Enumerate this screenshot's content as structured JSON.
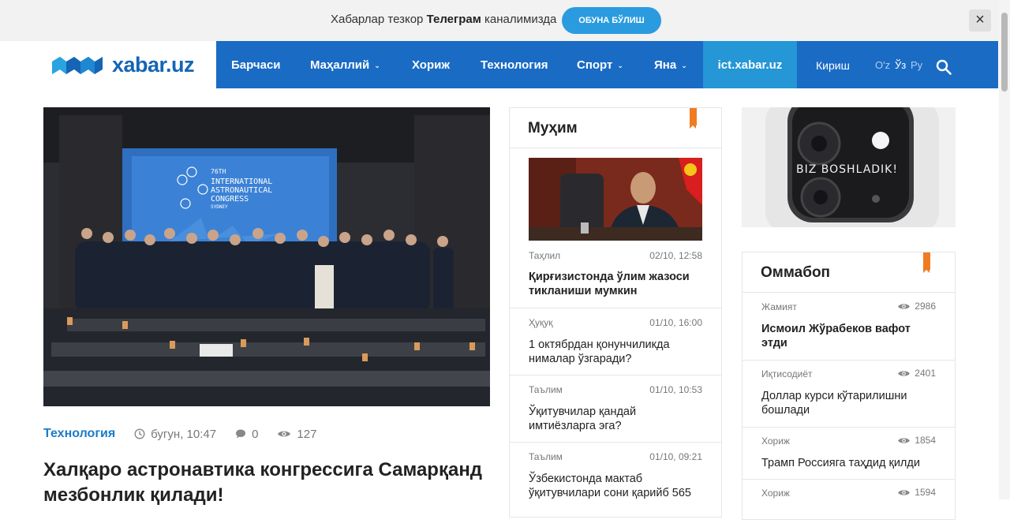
{
  "banner": {
    "text_before": "Хабарлар тезкор",
    "text_bold": "Телеграм",
    "text_after": "каналимизда",
    "subscribe_label": "ОБУНА БЎЛИШ",
    "close_label": "×"
  },
  "logo": {
    "text": "xabar.uz",
    "color": "#1565b5"
  },
  "nav": {
    "items": [
      {
        "label": "Барчаси",
        "dropdown": false
      },
      {
        "label": "Маҳаллий",
        "dropdown": true
      },
      {
        "label": "Хориж",
        "dropdown": false
      },
      {
        "label": "Технология",
        "dropdown": false
      },
      {
        "label": "Спорт",
        "dropdown": true
      },
      {
        "label": "Яна",
        "dropdown": true
      }
    ],
    "ict_label": "ict.xabar.uz",
    "login_label": "Кириш",
    "languages": [
      "O'z",
      "Ўз",
      "Ру"
    ],
    "active_language": "Ўз",
    "search_icon": "search-icon",
    "bg_color": "#1a6bc4",
    "ict_color": "#2596d6"
  },
  "hero": {
    "image_text": {
      "line1": "76TH",
      "line2": "INTERNATIONAL",
      "line3": "ASTRONAUTICAL",
      "line4": "CONGRESS",
      "line5": "SYDNEY"
    },
    "category": "Технология",
    "time": "бугун, 10:47",
    "comments": "0",
    "views": "127",
    "title": "Халқаро астронавтика конгрессига Самарқанд мезбонлик қилади!"
  },
  "muhim": {
    "heading": "Муҳим",
    "items": [
      {
        "category": "Таҳлил",
        "time": "02/10, 12:58",
        "title": "Қирғизистонда ўлим жазоси тикланиши мумкин",
        "bold": true
      },
      {
        "category": "Ҳуқуқ",
        "time": "01/10, 16:00",
        "title": "1 октябрдан қонунчиликда нималар ўзгаради?",
        "bold": false
      },
      {
        "category": "Таълим",
        "time": "01/10, 10:53",
        "title": "Ўқитувчилар қандай имтиёзларга эга?",
        "bold": false
      },
      {
        "category": "Таълим",
        "time": "01/10, 09:21",
        "title": "Ўзбекистонда мактаб ўқитувчилари сони қарийб 565",
        "bold": false
      }
    ]
  },
  "ad": {
    "text": "BIZ BOSHLADIK!"
  },
  "ommabop": {
    "heading": "Оммабоп",
    "items": [
      {
        "category": "Жамият",
        "views": "2986",
        "title": "Исмоил Жўрабеков вафот этди",
        "bold": true
      },
      {
        "category": "Иқтисодиёт",
        "views": "2401",
        "title": "Доллар курси кўтарилишни бошлади",
        "bold": false
      },
      {
        "category": "Хориж",
        "views": "1854",
        "title": "Трамп Россияга таҳдид қилди",
        "bold": false
      },
      {
        "category": "Хориж",
        "views": "1594",
        "title": "",
        "bold": false
      }
    ]
  },
  "colors": {
    "accent": "#1a7bc8",
    "bookmark": "#f07b22"
  }
}
